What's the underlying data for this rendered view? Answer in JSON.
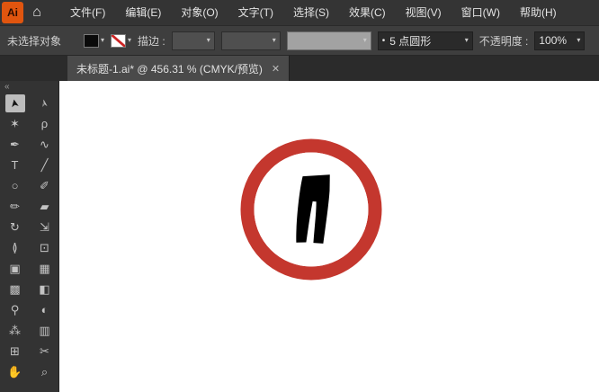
{
  "menubar": {
    "logo": "Ai",
    "items": [
      "文件(F)",
      "编辑(E)",
      "对象(O)",
      "文字(T)",
      "选择(S)",
      "效果(C)",
      "视图(V)",
      "窗口(W)",
      "帮助(H)"
    ]
  },
  "control_bar": {
    "status": "未选择对象",
    "stroke_label": "描边 :",
    "brush_bullet": "•",
    "brush_name": "5 点圆形",
    "opacity_label": "不透明度 :",
    "opacity_value": "100%"
  },
  "tab": {
    "title": "未标题-1.ai* @ 456.31 % (CMYK/预览)"
  },
  "icons": {
    "home": "⌂",
    "caret": "▾",
    "close": "✕",
    "collapse": "«"
  },
  "toolbar": {
    "tools": [
      {
        "name": "selection",
        "glyph": "➤"
      },
      {
        "name": "direct-selection",
        "glyph": "➢"
      },
      {
        "name": "magic-wand",
        "glyph": "✶"
      },
      {
        "name": "lasso",
        "glyph": "ρ"
      },
      {
        "name": "pen",
        "glyph": "✒"
      },
      {
        "name": "curvature",
        "glyph": "∿"
      },
      {
        "name": "type",
        "glyph": "T"
      },
      {
        "name": "line-segment",
        "glyph": "╱"
      },
      {
        "name": "ellipse",
        "glyph": "○"
      },
      {
        "name": "paintbrush",
        "glyph": "✐"
      },
      {
        "name": "pencil",
        "glyph": "✏"
      },
      {
        "name": "eraser",
        "glyph": "▰"
      },
      {
        "name": "rotate",
        "glyph": "↻"
      },
      {
        "name": "scale",
        "glyph": "⇲"
      },
      {
        "name": "width",
        "glyph": "≬"
      },
      {
        "name": "free-transform",
        "glyph": "⊡"
      },
      {
        "name": "shape-builder",
        "glyph": "▣"
      },
      {
        "name": "perspective-grid",
        "glyph": "▦"
      },
      {
        "name": "mesh",
        "glyph": "▩"
      },
      {
        "name": "gradient",
        "glyph": "◧"
      },
      {
        "name": "eyedropper",
        "glyph": "⚲"
      },
      {
        "name": "blend",
        "glyph": "◐"
      },
      {
        "name": "symbol-sprayer",
        "glyph": "⁂"
      },
      {
        "name": "column-graph",
        "glyph": "▥"
      },
      {
        "name": "artboard",
        "glyph": "⊞"
      },
      {
        "name": "slice",
        "glyph": "✂"
      },
      {
        "name": "hand",
        "glyph": "✋"
      },
      {
        "name": "zoom",
        "glyph": "⌕"
      }
    ]
  },
  "artwork": {
    "ring_color": "#c4372e",
    "inner_color": "#ffffff",
    "pants_color": "#000000"
  }
}
